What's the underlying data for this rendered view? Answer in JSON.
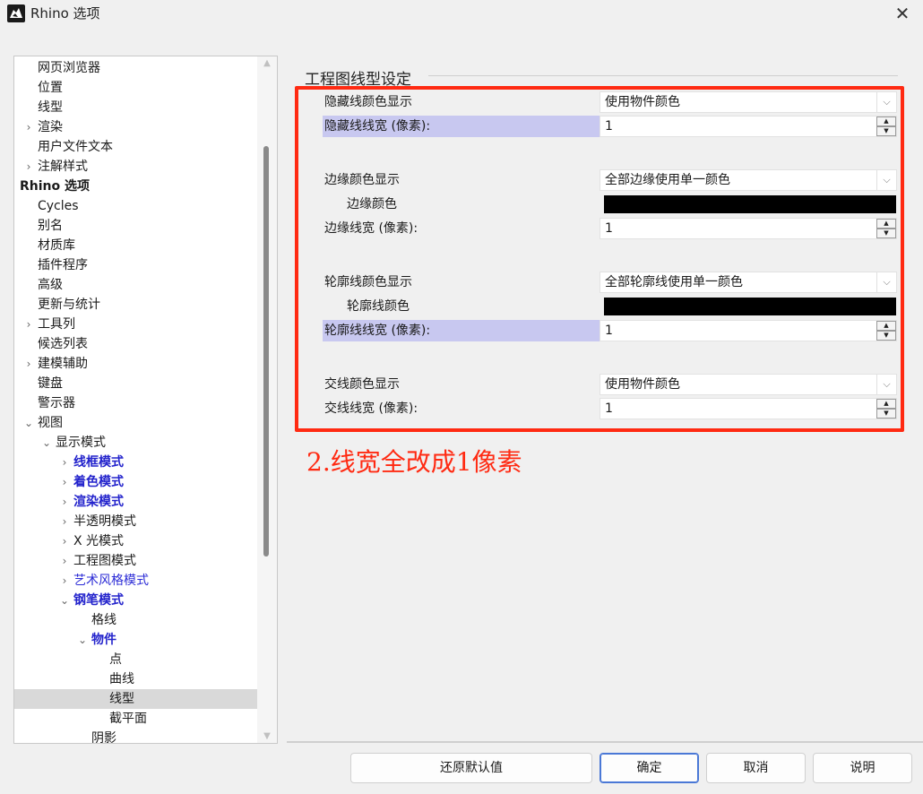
{
  "window": {
    "title": "Rhino 选项",
    "close_glyph": "✕"
  },
  "tree": {
    "items": [
      {
        "label": "网页浏览器",
        "arrow": "",
        "indent": 1,
        "style": ""
      },
      {
        "label": "位置",
        "arrow": "",
        "indent": 1,
        "style": ""
      },
      {
        "label": "线型",
        "arrow": "",
        "indent": 1,
        "style": ""
      },
      {
        "label": "渲染",
        "arrow": "›",
        "indent": 1,
        "style": ""
      },
      {
        "label": "用户文件文本",
        "arrow": "",
        "indent": 1,
        "style": ""
      },
      {
        "label": "注解样式",
        "arrow": "›",
        "indent": 1,
        "style": ""
      },
      {
        "label": "Rhino 选项",
        "arrow": "",
        "indent": 0,
        "style": "bold"
      },
      {
        "label": "Cycles",
        "arrow": "",
        "indent": 1,
        "style": ""
      },
      {
        "label": "别名",
        "arrow": "",
        "indent": 1,
        "style": ""
      },
      {
        "label": "材质库",
        "arrow": "",
        "indent": 1,
        "style": ""
      },
      {
        "label": "插件程序",
        "arrow": "",
        "indent": 1,
        "style": ""
      },
      {
        "label": "高级",
        "arrow": "",
        "indent": 1,
        "style": ""
      },
      {
        "label": "更新与统计",
        "arrow": "",
        "indent": 1,
        "style": ""
      },
      {
        "label": "工具列",
        "arrow": "›",
        "indent": 1,
        "style": ""
      },
      {
        "label": "候选列表",
        "arrow": "",
        "indent": 1,
        "style": ""
      },
      {
        "label": "建模辅助",
        "arrow": "›",
        "indent": 1,
        "style": ""
      },
      {
        "label": "键盘",
        "arrow": "",
        "indent": 1,
        "style": ""
      },
      {
        "label": "警示器",
        "arrow": "",
        "indent": 1,
        "style": ""
      },
      {
        "label": "视图",
        "arrow": "⌄",
        "indent": 1,
        "style": ""
      },
      {
        "label": "显示模式",
        "arrow": "⌄",
        "indent": 2,
        "style": ""
      },
      {
        "label": "线框模式",
        "arrow": "›",
        "indent": 3,
        "style": "bluebold"
      },
      {
        "label": "着色模式",
        "arrow": "›",
        "indent": 3,
        "style": "bluebold"
      },
      {
        "label": "渲染模式",
        "arrow": "›",
        "indent": 3,
        "style": "bluebold"
      },
      {
        "label": "半透明模式",
        "arrow": "›",
        "indent": 3,
        "style": ""
      },
      {
        "label": "X 光模式",
        "arrow": "›",
        "indent": 3,
        "style": ""
      },
      {
        "label": "工程图模式",
        "arrow": "›",
        "indent": 3,
        "style": ""
      },
      {
        "label": "艺术风格模式",
        "arrow": "›",
        "indent": 3,
        "style": "blue"
      },
      {
        "label": "钢笔模式",
        "arrow": "⌄",
        "indent": 3,
        "style": "bluebold"
      },
      {
        "label": "格线",
        "arrow": "",
        "indent": 4,
        "style": ""
      },
      {
        "label": "物件",
        "arrow": "⌄",
        "indent": 4,
        "style": "bluebold"
      },
      {
        "label": "点",
        "arrow": "",
        "indent": 5,
        "style": ""
      },
      {
        "label": "曲线",
        "arrow": "",
        "indent": 5,
        "style": ""
      },
      {
        "label": "线型",
        "arrow": "",
        "indent": 5,
        "style": "",
        "selected": true
      },
      {
        "label": "截平面",
        "arrow": "",
        "indent": 5,
        "style": ""
      },
      {
        "label": "阴影",
        "arrow": "",
        "indent": 4,
        "style": ""
      }
    ]
  },
  "panel": {
    "section_title": "工程图线型设定",
    "hidden_color_label": "隐藏线颜色显示",
    "hidden_color_value": "使用物件颜色",
    "hidden_width_label": "隐藏线线宽 (像素):",
    "hidden_width_value": "1",
    "edge_color_label": "边缘颜色显示",
    "edge_color_value": "全部边缘使用单一颜色",
    "edge_swatch_label": "边缘颜色",
    "edge_width_label": "边缘线宽 (像素):",
    "edge_width_value": "1",
    "silhouette_color_label": "轮廓线颜色显示",
    "silhouette_color_value": "全部轮廓线使用单一颜色",
    "silhouette_swatch_label": "轮廓线颜色",
    "silhouette_width_label": "轮廓线线宽 (像素):",
    "silhouette_width_value": "1",
    "intersect_color_label": "交线颜色显示",
    "intersect_color_value": "使用物件颜色",
    "intersect_width_label": "交线线宽 (像素):",
    "intersect_width_value": "1"
  },
  "annotation": {
    "text": "2.线宽全改成1像素",
    "color": "#ff2a12"
  },
  "buttons": {
    "restore_defaults": "还原默认值",
    "ok": "确定",
    "cancel": "取消",
    "help": "说明"
  },
  "icons": {
    "combo_chevron": "chevron-down-icon",
    "spin_up": "spin-up-icon",
    "spin_down": "spin-down-icon"
  }
}
